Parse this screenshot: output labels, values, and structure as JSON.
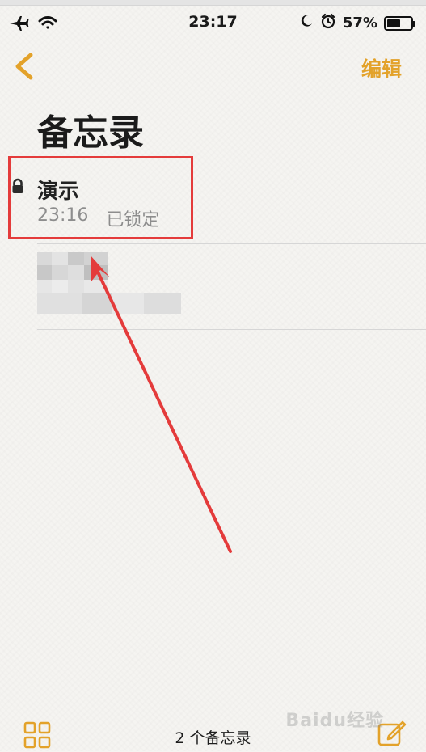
{
  "status_bar": {
    "time": "23:17",
    "battery_percent_text": "57%",
    "battery_level": 0.57
  },
  "nav": {
    "edit_label": "编辑",
    "back_icon": "chevron-left-icon"
  },
  "page": {
    "title": "备忘录"
  },
  "notes": [
    {
      "title": "演示",
      "time": "23:16",
      "status": "已锁定",
      "locked": true
    }
  ],
  "footer": {
    "count_label": "2 个备忘录",
    "watermark": "Baidu经验"
  },
  "colors": {
    "accent": "#e3a22a",
    "highlight_box": "#e43b3b",
    "arrow": "#e43b3b",
    "background": "#f5f4f1"
  }
}
